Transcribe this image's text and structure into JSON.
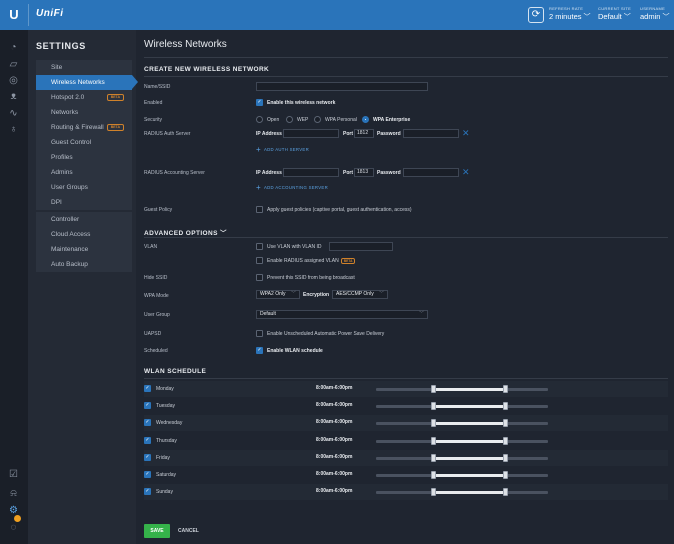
{
  "topbar": {
    "logo_mark": "U",
    "logo_text": "UniFi",
    "refresh_label": "REFRESH RATE",
    "refresh_value": "2 minutes",
    "site_label": "CURRENT SITE",
    "site_value": "Default",
    "user_label": "USERNAME",
    "user_value": "admin"
  },
  "rail": {
    "icons": [
      "dashboard-icon",
      "map-icon",
      "devices-icon",
      "clients-icon",
      "statistics-icon",
      "insights-icon",
      "alerts-icon",
      "events-icon",
      "settings-icon",
      "chat-icon"
    ]
  },
  "settings": {
    "title": "SETTINGS",
    "items": [
      {
        "label": "Site"
      },
      {
        "label": "Wireless Networks",
        "active": true
      },
      {
        "label": "Hotspot 2.0",
        "beta": "BETA"
      },
      {
        "label": "Networks"
      },
      {
        "label": "Routing & Firewall",
        "beta": "BETA"
      },
      {
        "label": "Guest Control"
      },
      {
        "label": "Profiles"
      },
      {
        "label": "Admins"
      },
      {
        "label": "User Groups"
      },
      {
        "label": "DPI"
      },
      {
        "label": "Controller"
      },
      {
        "label": "Cloud Access"
      },
      {
        "label": "Maintenance"
      },
      {
        "label": "Auto Backup"
      }
    ]
  },
  "main": {
    "title": "Wireless Networks",
    "create_heading": "CREATE NEW WIRELESS NETWORK",
    "name_label": "Name/SSID",
    "name_value": "",
    "enabled_label": "Enabled",
    "enabled_text": "Enable this wireless network",
    "security_label": "Security",
    "security_options": [
      "Open",
      "WEP",
      "WPA Personal",
      "WPA Enterprise"
    ],
    "security_selected": "WPA Enterprise",
    "auth_label": "RADIUS Auth Server",
    "ip_label": "IP Address",
    "port_label": "Port",
    "password_label": "Password",
    "auth_port": "1812",
    "add_auth": "ADD AUTH SERVER",
    "acct_label": "RADIUS Accounting Server",
    "acct_port": "1813",
    "add_acct": "ADD ACCOUNTING SERVER",
    "guest_label": "Guest Policy",
    "guest_text": "Apply guest policies (captive portal, guest authentication, access)",
    "advanced_heading": "ADVANCED OPTIONS",
    "vlan_label": "VLAN",
    "vlan_text": "Use VLAN  with VLAN ID",
    "radius_vlan_text": "Enable RADIUS assigned VLAN",
    "radius_vlan_beta": "BETA",
    "hide_ssid_label": "Hide SSID",
    "hide_ssid_text": "Prevent this SSID from being broadcast",
    "wpa_mode_label": "WPA Mode",
    "wpa_mode_value": "WPA2 Only",
    "encryption_label": "Encryption",
    "encryption_value": "AES/CCMP Only",
    "user_group_label": "User Group",
    "user_group_value": "Default",
    "uapsd_label": "UAPSD",
    "uapsd_text": "Enable Unscheduled Automatic Power Save Delivery",
    "scheduled_label": "Scheduled",
    "scheduled_text": "Enable WLAN schedule",
    "schedule_heading": "WLAN SCHEDULE",
    "schedule": [
      {
        "day": "Monday",
        "time": "8:00am-6:00pm",
        "start_frac": 0.333,
        "end_frac": 0.75
      },
      {
        "day": "Tuesday",
        "time": "8:00am-6:00pm",
        "start_frac": 0.333,
        "end_frac": 0.75
      },
      {
        "day": "Wednesday",
        "time": "8:00am-6:00pm",
        "start_frac": 0.333,
        "end_frac": 0.75
      },
      {
        "day": "Thursday",
        "time": "8:00am-6:00pm",
        "start_frac": 0.333,
        "end_frac": 0.75
      },
      {
        "day": "Friday",
        "time": "8:00am-6:00pm",
        "start_frac": 0.333,
        "end_frac": 0.75
      },
      {
        "day": "Saturday",
        "time": "8:00am-6:00pm",
        "start_frac": 0.333,
        "end_frac": 0.75
      },
      {
        "day": "Sunday",
        "time": "8:00am-6:00pm",
        "start_frac": 0.333,
        "end_frac": 0.75
      }
    ],
    "save_label": "SAVE",
    "cancel_label": "CANCEL"
  },
  "colors": {
    "accent": "#2a74ba",
    "save": "#35b24a",
    "beta": "#d0822b"
  }
}
